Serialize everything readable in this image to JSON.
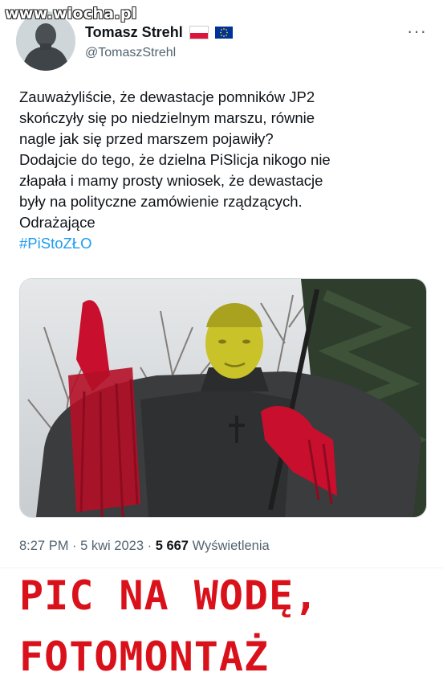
{
  "watermark": "www.wiocha.pl",
  "author": {
    "name": "Tomasz Strehl",
    "handle": "@TomaszStrehl",
    "flags": [
      "flag-pl-icon",
      "flag-eu-icon"
    ]
  },
  "more_menu": "···",
  "tweet": {
    "lines": [
      "Zauważyliście, że dewastacje pomników JP2",
      "skończyły się po niedzielnym marszu, równie",
      "nagle jak się przed marszem pojawiły?",
      "Dodajcie do tego, że dzielna PiSlicja nikogo nie",
      "złapała i mamy prosty wniosek, że dewastacje",
      "były na polityczne zamówienie rządzących.",
      "Odrażające"
    ],
    "hashtag": "#PiStoZŁO"
  },
  "meta": {
    "time": "8:27 PM",
    "sep1": " · ",
    "date": "5 kwi 2023",
    "sep2": " · ",
    "views_count": "5 667",
    "views_label": " Wyświetlenia"
  },
  "caption": {
    "line1": "PIC NA WODĘ,",
    "line2": "FOTOMONTAŻ"
  },
  "colors": {
    "hashtag": "#1d9bf0",
    "caption": "#d9111b",
    "paint_red": "#c8102e",
    "paint_yellow": "#c9c229"
  }
}
